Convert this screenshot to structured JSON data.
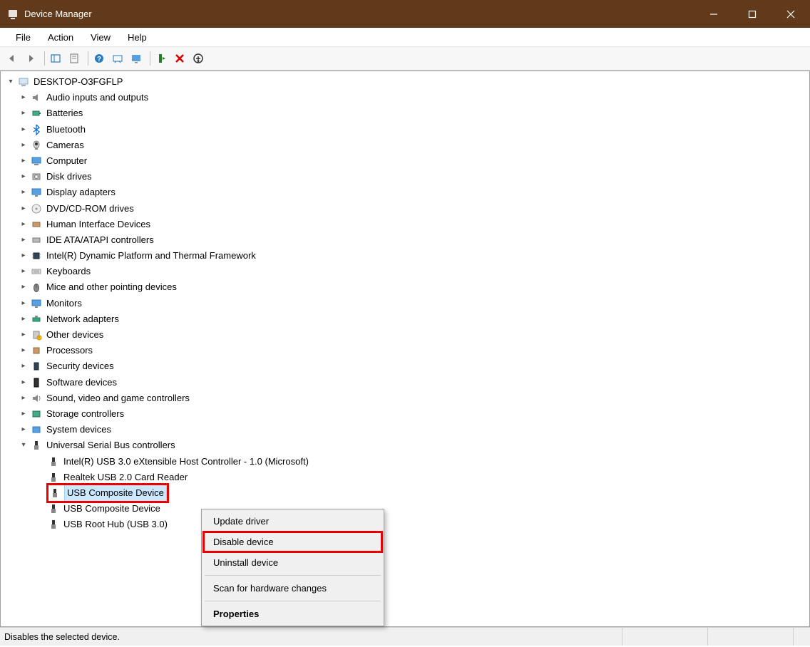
{
  "window": {
    "title": "Device Manager"
  },
  "menu": {
    "items": [
      "File",
      "Action",
      "View",
      "Help"
    ]
  },
  "tree": {
    "root": "DESKTOP-O3FGFLP",
    "categories": [
      {
        "label": "Audio inputs and outputs",
        "icon": "audio"
      },
      {
        "label": "Batteries",
        "icon": "battery"
      },
      {
        "label": "Bluetooth",
        "icon": "bluetooth"
      },
      {
        "label": "Cameras",
        "icon": "camera"
      },
      {
        "label": "Computer",
        "icon": "computer"
      },
      {
        "label": "Disk drives",
        "icon": "disk"
      },
      {
        "label": "Display adapters",
        "icon": "display"
      },
      {
        "label": "DVD/CD-ROM drives",
        "icon": "cd"
      },
      {
        "label": "Human Interface Devices",
        "icon": "hid"
      },
      {
        "label": "IDE ATA/ATAPI controllers",
        "icon": "ide"
      },
      {
        "label": "Intel(R) Dynamic Platform and Thermal Framework",
        "icon": "chip"
      },
      {
        "label": "Keyboards",
        "icon": "keyboard"
      },
      {
        "label": "Mice and other pointing devices",
        "icon": "mouse"
      },
      {
        "label": "Monitors",
        "icon": "monitor"
      },
      {
        "label": "Network adapters",
        "icon": "network"
      },
      {
        "label": "Other devices",
        "icon": "other"
      },
      {
        "label": "Processors",
        "icon": "cpu"
      },
      {
        "label": "Security devices",
        "icon": "security"
      },
      {
        "label": "Software devices",
        "icon": "software"
      },
      {
        "label": "Sound, video and game controllers",
        "icon": "sound"
      },
      {
        "label": "Storage controllers",
        "icon": "storage"
      },
      {
        "label": "System devices",
        "icon": "system"
      }
    ],
    "usb": {
      "label": "Universal Serial Bus controllers",
      "children": [
        "Intel(R) USB 3.0 eXtensible Host Controller - 1.0 (Microsoft)",
        "Realtek USB 2.0 Card Reader",
        "USB Composite Device",
        "USB Composite Device",
        "USB Root Hub (USB 3.0)"
      ],
      "selected_index": 2
    }
  },
  "context_menu": {
    "items": [
      {
        "label": "Update driver"
      },
      {
        "label": "Disable device",
        "highlighted": true
      },
      {
        "label": "Uninstall device"
      },
      {
        "sep": true
      },
      {
        "label": "Scan for hardware changes"
      },
      {
        "sep": true
      },
      {
        "label": "Properties",
        "bold": true
      }
    ]
  },
  "statusbar": {
    "text": "Disables the selected device."
  },
  "colors": {
    "titlebar": "#603a1b",
    "highlight": "#e60000",
    "selection": "#cce8ff"
  }
}
